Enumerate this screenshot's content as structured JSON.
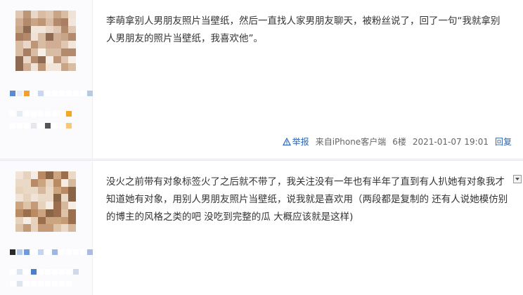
{
  "posts": [
    {
      "content": "李萌拿别人男朋友照片当壁纸，然后一直找人家男朋友聊天，被粉丝说了，回了一句“我就拿别人男朋友的照片当壁纸，我喜欢他”。",
      "tail": {
        "report_label": "举报",
        "source": "来自iPhone客户端",
        "floor": "6楼",
        "time": "2021-01-07 19:01",
        "reply_label": "回复"
      }
    },
    {
      "content": "没火之前带有对象标签火了之后就不带了，我关注没有一年也有半年了直到有人扒她有对象我才知道她有对象，用别人男朋友照片当壁纸，说我就是喜欢用（两段都是复制的 还有人说她模仿别的博主的风格之类的吧 没吃到完整的瓜 大概应该就是这样)"
    }
  ],
  "colors": {
    "link": "#2d64b3",
    "text": "#333333",
    "meta": "#666666",
    "divider": "#e4e6eb"
  },
  "icons": [
    "warning-triangle-icon",
    "chevron-down-icon"
  ]
}
